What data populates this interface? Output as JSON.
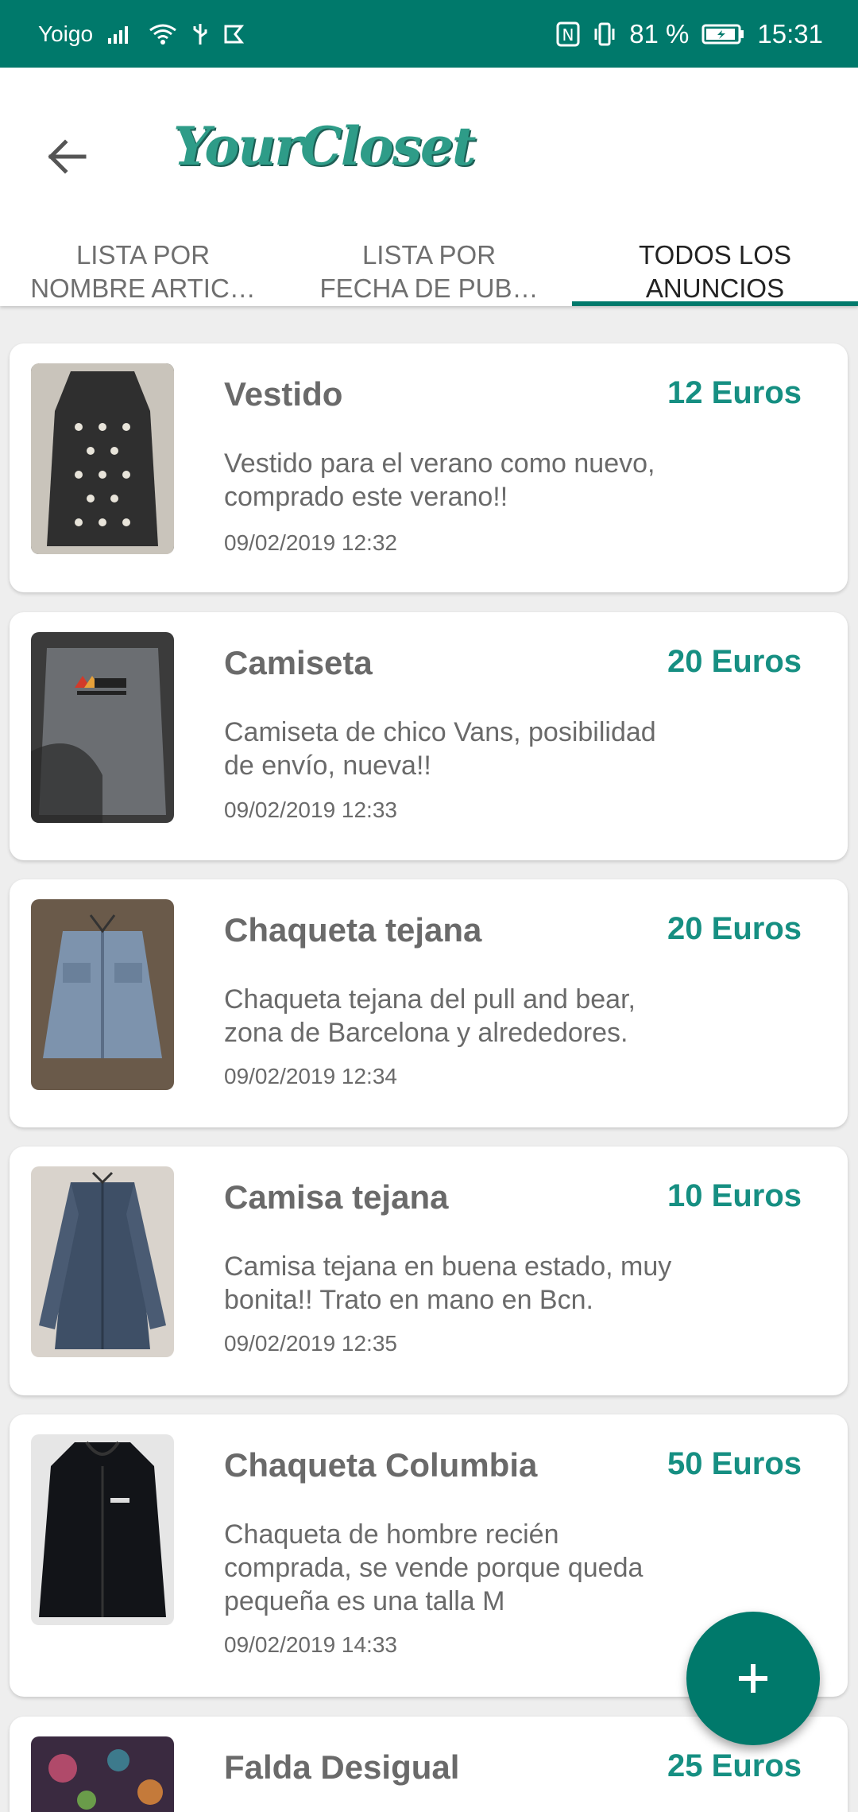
{
  "status_bar": {
    "carrier": "Yoigo",
    "battery": "81 %",
    "time": "15:31"
  },
  "header": {
    "app_title": "YourCloset",
    "back_icon": "arrow-left-icon"
  },
  "tabs": [
    {
      "label": "LISTA POR\nNOMBRE ARTIC…",
      "active": false
    },
    {
      "label": "LISTA POR\nFECHA DE PUB…",
      "active": false
    },
    {
      "label": "TODOS LOS\nANUNCIOS",
      "active": true
    }
  ],
  "listings": [
    {
      "title": "Vestido",
      "price": "12 Euros",
      "description": "Vestido para el verano como nuevo, comprado este verano!!",
      "date": "09/02/2019  12:32"
    },
    {
      "title": "Camiseta",
      "price": "20 Euros",
      "description": "Camiseta de chico Vans, posibilidad de envío, nueva!!",
      "date": "09/02/2019  12:33"
    },
    {
      "title": "Chaqueta tejana",
      "price": "20 Euros",
      "description": "Chaqueta tejana del pull and bear, zona de Barcelona y alrededores.",
      "date": "09/02/2019  12:34"
    },
    {
      "title": "Camisa tejana",
      "price": "10 Euros",
      "description": "Camisa tejana en buena estado, muy bonita!! Trato en mano en Bcn.",
      "date": "09/02/2019  12:35"
    },
    {
      "title": "Chaqueta Columbia",
      "price": "50 Euros",
      "description": "Chaqueta de hombre recién comprada, se vende porque queda pequeña es una talla M",
      "date": "09/02/2019  14:33"
    },
    {
      "title": "Falda Desigual",
      "price": "25 Euros",
      "description": "",
      "date": ""
    }
  ],
  "fab": {
    "icon": "plus-icon"
  },
  "colors": {
    "primary": "#00796b",
    "price": "#168f82",
    "logo": "#2e9c88"
  }
}
